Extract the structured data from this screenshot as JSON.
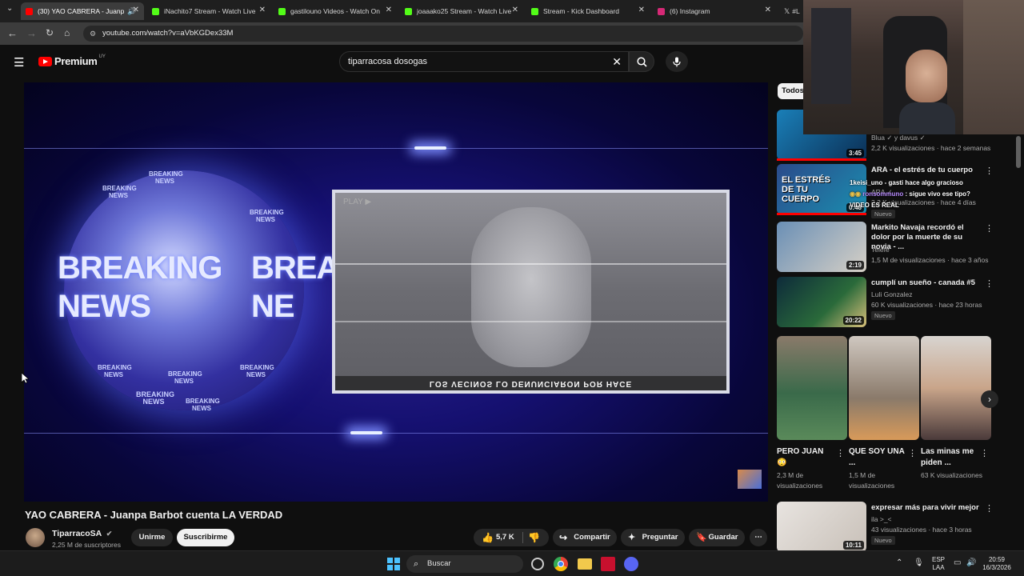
{
  "browser": {
    "tabs": [
      {
        "label": "(30) YAO CABRERA - Juanp",
        "color": "#ff0000",
        "active": true
      },
      {
        "label": "iNachito7 Stream - Watch Live",
        "color": "#53fc18"
      },
      {
        "label": "gastilouno Videos - Watch On",
        "color": "#53fc18"
      },
      {
        "label": "joaaako25 Stream - Watch Live",
        "color": "#53fc18"
      },
      {
        "label": "Stream - Kick Dashboard",
        "color": "#53fc18"
      },
      {
        "label": "(6) Instagram",
        "color": "#d62976"
      },
      {
        "label": "#L",
        "color": "#ffffff"
      }
    ],
    "url": "youtube.com/watch?v=aVbKGDex33M"
  },
  "header": {
    "logo": "Premium",
    "logo_region": "UY",
    "search_value": "tiparracosa dosogas"
  },
  "video": {
    "overlay_left": [
      "BREAKING",
      "NEWS"
    ],
    "overlay_right": [
      "BREA",
      "NE"
    ],
    "small_news": "BREAKING NEWS",
    "inset_caption": "LOS VECINOS LO DENUNCIARON POR HACE",
    "inset_play": "PLAY ▶",
    "title": "YAO CABRERA - Juanpa Barbot cuenta LA VERDAD",
    "channel": "TiparracoSA",
    "subscribers": "2,25 M de suscriptores",
    "join": "Unirme",
    "subscribe": "Suscribirme",
    "likes": "5,7 K",
    "share": "Compartir",
    "ask": "Preguntar",
    "save": "Guardar"
  },
  "sidebar": {
    "chip": "Todos",
    "recs": [
      {
        "title": "",
        "channel": "Blua ✓ y davus ✓",
        "meta": "2,2 K visualizaciones · hace 2 semanas",
        "duration": "3:45"
      },
      {
        "title": "ARA - el estrés de tu cuerpo",
        "channel": "ARA ✓",
        "meta": "2,2 K visualizaciones · hace 4 días",
        "duration": "0:48",
        "badge": "Nuevo",
        "thumb_text": "EL ESTRÉS DE TU CUERPO"
      },
      {
        "title": "Markito Navaja recordó el dolor por la muerte de su novia - ...",
        "channel": "Telefe",
        "meta": "1,5 M de visualizaciones · hace 3 años",
        "duration": "2:19"
      },
      {
        "title": "cumplí un sueño - canada #5",
        "channel": "Luli Gonzalez",
        "meta": "60 K visualizaciones · hace 23 horas",
        "duration": "20:22",
        "badge": "Nuevo"
      },
      {
        "title": "expresar más para vivir mejor",
        "channel": "ila >_<",
        "meta": "43 visualizaciones · hace 3 horas",
        "duration": "10:11",
        "badge": "Nuevo"
      }
    ],
    "shorts": [
      {
        "title": "PERO JUAN 😳",
        "views": "2,3 M de visualizaciones"
      },
      {
        "title": "QUE SOY UNA ...",
        "views": "1,5 M de visualizaciones"
      },
      {
        "title": "Las minas me piden ...",
        "views": "63 K visualizaciones"
      }
    ]
  },
  "chat": [
    {
      "user": "1keisi_uno",
      "text": "- gasti hace algo gracioso",
      "user_color": "#ffffff"
    },
    {
      "user": "ronsommuno",
      "text": ": sigue vivo ese tipo?",
      "user_color": "#b98cff"
    },
    {
      "user": "",
      "text": "VIDEO ES REAL",
      "user_color": "#ffffff"
    }
  ],
  "taskbar": {
    "search": "Buscar",
    "lang_top": "ESP",
    "lang_bottom": "LAA",
    "time": "20:59",
    "date": "16/3/2026"
  }
}
